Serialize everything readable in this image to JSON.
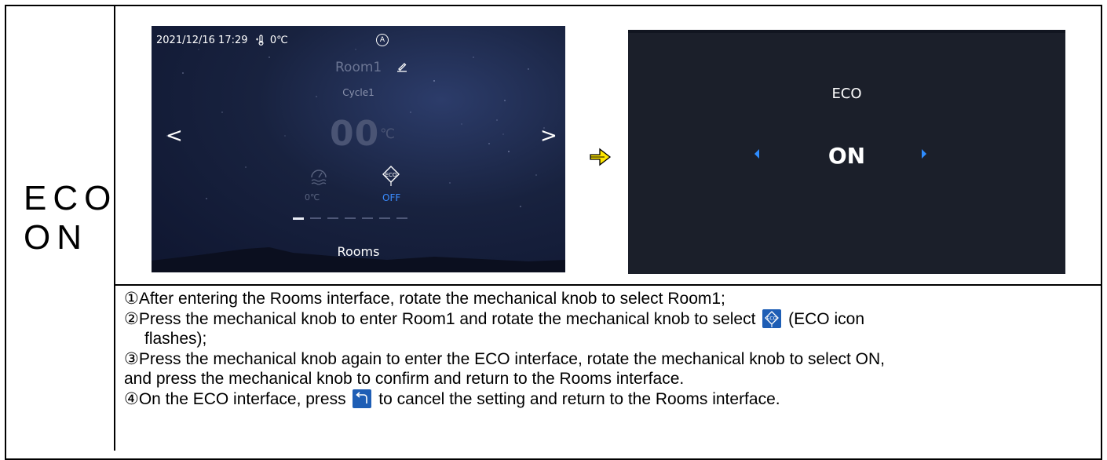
{
  "side_label": {
    "line1": "ECO",
    "line2": "ON"
  },
  "screen_rooms": {
    "datetime": "2021/12/16 17:29",
    "outdoor_temp": "0℃",
    "mode_badge": "A",
    "room_name": "Room1",
    "cycle": "Cycle1",
    "set_temp": "00",
    "temp_unit": "℃",
    "prev_arrow": "<",
    "next_arrow": ">",
    "water_temp": "0℃",
    "eco_status": "OFF",
    "page_indicator": {
      "total": 7,
      "active": 1
    },
    "nav_label": "Rooms",
    "eco_status_color": "#3a8cff"
  },
  "screen_eco": {
    "title": "ECO",
    "value": "ON",
    "arrow_color": "#2e8cff"
  },
  "instructions": {
    "step1": "①After entering the Rooms interface, rotate the mechanical knob to select Room1;",
    "step2_a": "②Press the mechanical knob to enter Room1 and rotate the mechanical knob to select",
    "step2_b": "(ECO icon",
    "step2_c": "flashes);",
    "step3_a": "③Press the mechanical knob again to enter the ECO interface, rotate the mechanical knob to select ON,",
    "step3_b": "and press the mechanical knob to confirm and return to the Rooms interface.",
    "step4_a": "④On the ECO interface, press",
    "step4_b": "to cancel the setting and return to the Rooms interface."
  }
}
